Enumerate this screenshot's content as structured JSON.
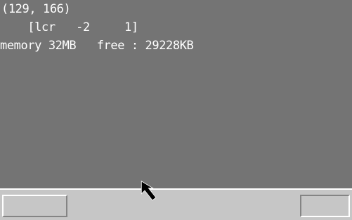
{
  "console": {
    "coordinates": "(129, 166)",
    "layer_line": "    [lcr   -2     1]",
    "memory_line": "memory 32MB   free : 29228KB"
  },
  "taskbar": {
    "start_button_label": "",
    "tray_button_label": ""
  },
  "cursor": {
    "icon": "mouse-arrow-icon"
  },
  "colors": {
    "desktop_bg": "#747474",
    "taskbar_bg": "#c6c6c6",
    "text": "#ffffff"
  }
}
